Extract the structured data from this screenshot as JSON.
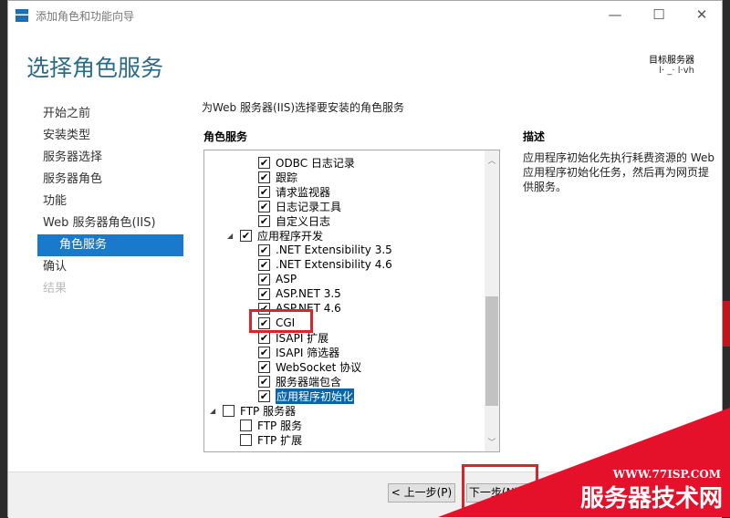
{
  "window": {
    "title": "添加角色和功能向导",
    "minimize": "—",
    "maximize": "☐",
    "close": "✕"
  },
  "page_title": "选择角色服务",
  "target": {
    "label": "目标服务器",
    "name": "l· _· l·vh"
  },
  "nav": [
    "开始之前",
    "安装类型",
    "服务器选择",
    "服务器角色",
    "功能",
    "Web 服务器角色(IIS)",
    "角色服务",
    "确认",
    "结果"
  ],
  "instruction": "为Web 服务器(IIS)选择要安装的角色服务",
  "roles_header": "角色服务",
  "desc_header": "描述",
  "description": "应用程序初始化先执行耗费资源的 Web 应用程序初始化任务，然后再为网页提供服务。",
  "tree": [
    {
      "label": "ODBC 日志记录",
      "checked": true,
      "level": 2
    },
    {
      "label": "跟踪",
      "checked": true,
      "level": 2
    },
    {
      "label": "请求监视器",
      "checked": true,
      "level": 2
    },
    {
      "label": "日志记录工具",
      "checked": true,
      "level": 2
    },
    {
      "label": "自定义日志",
      "checked": true,
      "level": 2
    },
    {
      "label": "应用程序开发",
      "checked": true,
      "level": 1,
      "expanded": true
    },
    {
      "label": ".NET Extensibility 3.5",
      "checked": true,
      "level": 2
    },
    {
      "label": ".NET Extensibility 4.6",
      "checked": true,
      "level": 2
    },
    {
      "label": "ASP",
      "checked": true,
      "level": 2
    },
    {
      "label": "ASP.NET 3.5",
      "checked": true,
      "level": 2
    },
    {
      "label": "ASP.NET 4.6",
      "checked": true,
      "level": 2
    },
    {
      "label": "CGI",
      "checked": true,
      "level": 2
    },
    {
      "label": "ISAPI 扩展",
      "checked": true,
      "level": 2
    },
    {
      "label": "ISAPI 筛选器",
      "checked": true,
      "level": 2
    },
    {
      "label": "WebSocket 协议",
      "checked": true,
      "level": 2
    },
    {
      "label": "服务器端包含",
      "checked": true,
      "level": 2
    },
    {
      "label": "应用程序初始化",
      "checked": true,
      "level": 2,
      "selected": true
    },
    {
      "label": "FTP 服务器",
      "checked": false,
      "level": 0,
      "expanded": true
    },
    {
      "label": "FTP 服务",
      "checked": false,
      "level": 1
    },
    {
      "label": "FTP 扩展",
      "checked": false,
      "level": 1
    }
  ],
  "buttons": {
    "prev": "< 上一步(P)",
    "next": "下一步(N) >"
  },
  "watermark": {
    "url": "WWW.77ISP.COM",
    "name": "服务器技术网"
  },
  "colors": {
    "accent": "#1979ca",
    "highlight": "#d9232d"
  }
}
